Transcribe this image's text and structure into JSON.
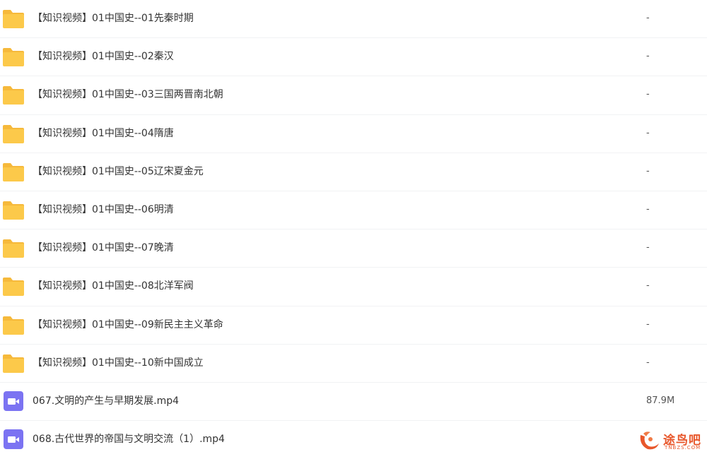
{
  "files": [
    {
      "type": "folder",
      "name": "【知识视频】01中国史--01先秦时期",
      "size": "-"
    },
    {
      "type": "folder",
      "name": "【知识视频】01中国史--02秦汉",
      "size": "-"
    },
    {
      "type": "folder",
      "name": "【知识视频】01中国史--03三国两晋南北朝",
      "size": "-"
    },
    {
      "type": "folder",
      "name": "【知识视频】01中国史--04隋唐",
      "size": "-"
    },
    {
      "type": "folder",
      "name": "【知识视频】01中国史--05辽宋夏金元",
      "size": "-"
    },
    {
      "type": "folder",
      "name": "【知识视频】01中国史--06明清",
      "size": "-"
    },
    {
      "type": "folder",
      "name": "【知识视频】01中国史--07晚清",
      "size": "-"
    },
    {
      "type": "folder",
      "name": "【知识视频】01中国史--08北洋军阀",
      "size": "-"
    },
    {
      "type": "folder",
      "name": "【知识视频】01中国史--09新民主主义革命",
      "size": "-"
    },
    {
      "type": "folder",
      "name": "【知识视频】01中国史--10新中国成立",
      "size": "-"
    },
    {
      "type": "video",
      "name": "067.文明的产生与早期发展.mp4",
      "size": "87.9M"
    },
    {
      "type": "video",
      "name": "068.古代世界的帝国与文明交流（1）.mp4",
      "size": ""
    }
  ],
  "watermark": {
    "text": "途鸟吧",
    "sub": "TNBZS.COM"
  },
  "colors": {
    "folder": "#fcc94a",
    "folder_tab": "#f6b93b",
    "video": "#7b73f2",
    "watermark": "#e8572b",
    "divider": "#f1f2f4"
  }
}
